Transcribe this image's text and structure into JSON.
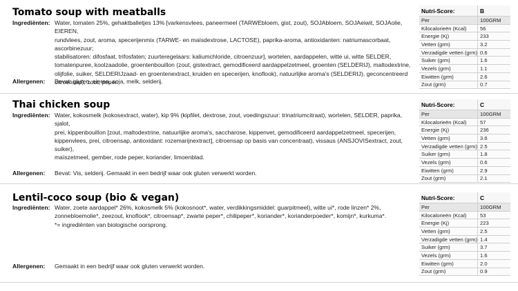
{
  "labels": {
    "ingredients": "Ingrediënten:",
    "allergens": "Allergenen:",
    "nutri_score": "Nutri-Score:"
  },
  "products": [
    {
      "title": "Tomato soup with meatballs",
      "ingredients": [
        "Water, tomaten 25%, gehaktballetjes 13% [varkensvlees, paneermeel (TARWEbloem, gist, zout), SOJAbloem, SOJAeiwit, SOJAolie, EIEREN,",
        "rundvlees, zout, aroma, specerijenmix (TARWE- en maïsdextrose, LACTOSE), paprika-aroma, antioxidanten: natriumascorbaat, ascorbinezuur;",
        "stabilisatoren: difosfaat, trifosfaten; zuurteregelaars: kaliumchloride, citroenzuur], wortelen, aardappelen, witte ui, witte SELDER,",
        "tomatenpuree, koolzaadolie, groentenbouillon (zout, gistextract, gemodificeerd aardappelzetmeel, groenten (SELDERIJ), maltodextrine,",
        "olijfolie, suiker, SELDERIJzaad- en groentenextract, kruiden en specerijen, knoflook), natuurlijke aroma's (SELDERIJ), geconcentreerd",
        "citroensap), zout, peper."
      ],
      "allergens": "Bevat: gluten, eieren, soja, melk, selderij.",
      "nutri_score": "B",
      "per_label": "Per",
      "per_unit": "100GRM",
      "nutrients": [
        {
          "name": "Kilocalorieën (Kcal)",
          "value": "56"
        },
        {
          "name": "Energie (Kj)",
          "value": "233"
        },
        {
          "name": "Vetten (grm)",
          "value": "3.2"
        },
        {
          "name": "Verzadigde vetten (grm)",
          "value": "0.6"
        },
        {
          "name": "Suiker (grm)",
          "value": "1.6"
        },
        {
          "name": "Vezels (grm)",
          "value": "1.1"
        },
        {
          "name": "Eiwitten (grm)",
          "value": "2.6"
        },
        {
          "name": "Zout (grm)",
          "value": "0.7"
        }
      ]
    },
    {
      "title": "Thai chicken soup",
      "ingredients": [
        "Water, kokosmelk (kokosextract, water), kip 9% (kipfilet, dextrose, zout, voedingszuur: trinatriumcitraat), wortelen, SELDER, paprika, sjalot,",
        "prei, kippenbouillon [zout, maltodextrine, natuurlijke aroma's, saccharose, kippenvet, gemodificeerd aardappelzetmeel, specerijen,",
        "kippenvlees, prei, citroensap, antioxidant: rozemarijnextract], citroensap op basis van concentraat), vissaus (ANSJOVISextract, zout, suiker),",
        "maïszetmeel, gember, rode peper, koriander, limoenblad."
      ],
      "allergens": "Bevat: Vis, selderij. Gemaakt in een bedrijf waar ook gluten verwerkt worden.",
      "nutri_score": "C",
      "per_label": "Per",
      "per_unit": "100GRM",
      "nutrients": [
        {
          "name": "Kilocalorieën (Kcal)",
          "value": "57"
        },
        {
          "name": "Energie (Kj)",
          "value": "236"
        },
        {
          "name": "Vetten (grm)",
          "value": "3.6"
        },
        {
          "name": "Verzadigde vetten (grm)",
          "value": "2.5"
        },
        {
          "name": "Suiker (grm)",
          "value": "1.8"
        },
        {
          "name": "Vezels (grm)",
          "value": "0.6"
        },
        {
          "name": "Eiwitten (grm)",
          "value": "2.9"
        },
        {
          "name": "Zout (grm)",
          "value": "2.1"
        }
      ]
    },
    {
      "title": "Lentil-coco soup (bio & vegan)",
      "ingredients": [
        "Water, zoete aardappel* 26%, kokosmelk 5% (kokosnoot*, water, verdikkingsmiddel: guarpitmeel), witte ui*,  rode linzen* 2%,",
        "zonnebloemolie*, zeezout, knoflook*, citroensap*, zwarte peper*, chilipeper*, koriander*, korianderpoeder*, komijn*, kurkuma*.",
        "*= ingrediënten van biologische oorsprong."
      ],
      "allergens": "Gemaakt in een bedrijf waar ook gluten verwerkt worden.",
      "nutri_score": "C",
      "per_label": "Per",
      "per_unit": "100GRM",
      "nutrients": [
        {
          "name": "Kilocalorieën (Kcal)",
          "value": "53"
        },
        {
          "name": "Energie (Kj)",
          "value": "223"
        },
        {
          "name": "Vetten (grm)",
          "value": "2.5"
        },
        {
          "name": "Verzadigde vetten (grm)",
          "value": "1.4"
        },
        {
          "name": "Suiker (grm)",
          "value": "3.7"
        },
        {
          "name": "Vezels (grm)",
          "value": "1.6"
        },
        {
          "name": "Eiwitten (grm)",
          "value": "2.0"
        },
        {
          "name": "Zout (grm)",
          "value": "0.9"
        }
      ]
    }
  ]
}
